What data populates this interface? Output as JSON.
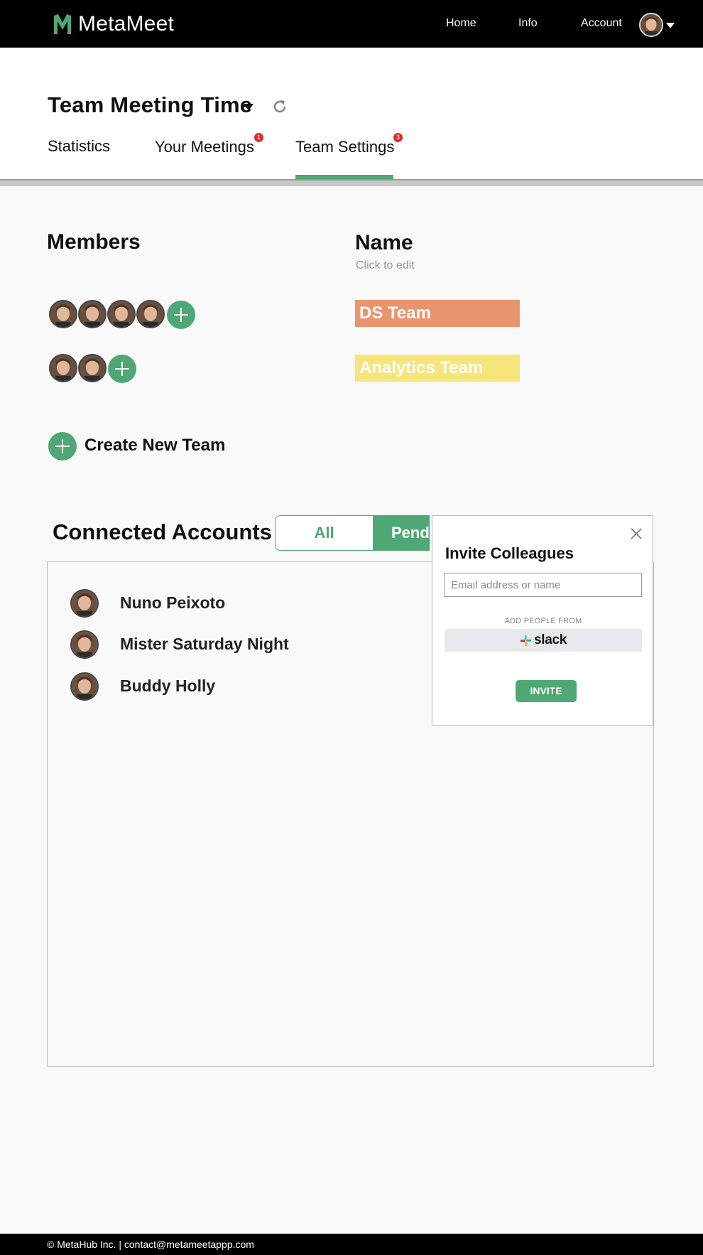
{
  "nav": {
    "brand": "MetaMeet",
    "links": [
      "Home",
      "Info",
      "Account"
    ]
  },
  "header": {
    "title": "Team Meeting Time",
    "tabs": [
      {
        "label": "Statistics",
        "badge": ""
      },
      {
        "label": "Your Meetings",
        "badge": "1"
      },
      {
        "label": "Team Settings",
        "badge": "3"
      }
    ],
    "active_tab": "Team Settings"
  },
  "members": {
    "heading": "Members",
    "name_heading": "Name",
    "name_hint": "Click to edit",
    "teams": [
      {
        "name": "DS Team",
        "member_count": 4,
        "color": "#e8956f"
      },
      {
        "name": "Analytics Team",
        "member_count": 2,
        "color": "#f5e57a"
      }
    ],
    "create_label": "Create New Team"
  },
  "connected": {
    "heading": "Connected Accounts",
    "filter_all": "All",
    "filter_pending": "Pending",
    "accounts": [
      "Nuno Peixoto",
      "Mister Saturday Night",
      "Buddy Holly"
    ]
  },
  "invite": {
    "title": "Invite Colleagues",
    "placeholder": "Email address or name",
    "add_from": "ADD PEOPLE FROM",
    "slack": "slack",
    "button": "INVITE"
  },
  "footer": {
    "text": "© MetaHub Inc. | contact@metameetappp.com"
  },
  "colors": {
    "accent": "#4fa775",
    "badge": "#e32b2b"
  }
}
